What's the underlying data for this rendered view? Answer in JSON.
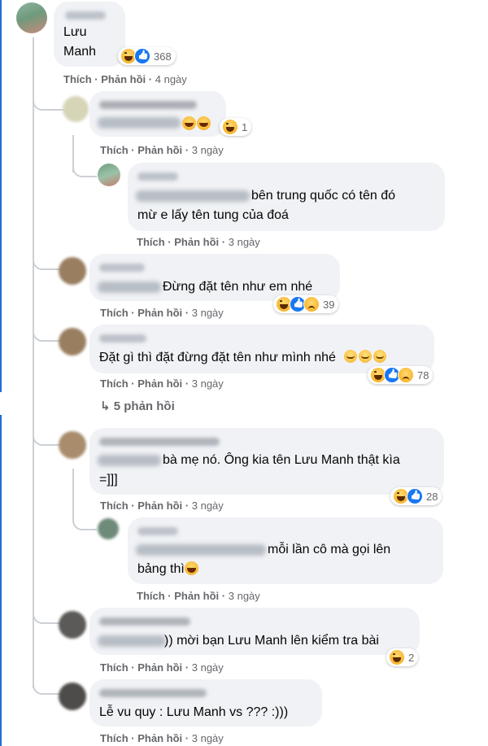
{
  "labels": {
    "like": "Thích",
    "reply": "Phản hồi",
    "sep": "·"
  },
  "comments": [
    {
      "text_lines": [
        "Lưu",
        "Manh"
      ],
      "reactions_count": "368",
      "time": "4 ngày"
    },
    {
      "reactions_count": "1",
      "time": "3 ngày"
    },
    {
      "text_lines": [
        "bên trung quốc có tên đó",
        "mừ e lấy tên tung của đoá"
      ],
      "time": "3 ngày"
    },
    {
      "text": "Đừng đặt tên như em nhé",
      "reactions_count": "39",
      "time": "3 ngày"
    },
    {
      "text": "Đặt gì thì đặt đừng đặt tên như mình nhé",
      "reactions_count": "78",
      "time": "3 ngày",
      "view_replies": "5 phản hồi"
    },
    {
      "text_lines": [
        "bà mẹ nó. Ông kia tên Lưu Manh thật kìa",
        "=]]]"
      ],
      "reactions_count": "28",
      "time": "3 ngày"
    },
    {
      "text_lines": [
        "mỗi lần cô mà gọi lên",
        "bảng thì"
      ],
      "time": "3 ngày"
    },
    {
      "text": ")) mời bạn Lưu Manh lên kiểm tra bài",
      "reactions_count": "2",
      "time": "3 ngày"
    },
    {
      "text": "Lễ vu quy : Lưu Manh vs ??? :)))",
      "time": "3 ngày"
    }
  ],
  "colors": {
    "bubble": "#f0f2f5",
    "meta": "#65676b",
    "accent": "#1877f2"
  },
  "icons": [
    "haha-icon",
    "like-icon",
    "sad-icon",
    "sleepy-icon",
    "laugh-cry-icon",
    "reply-arrow-icon"
  ]
}
